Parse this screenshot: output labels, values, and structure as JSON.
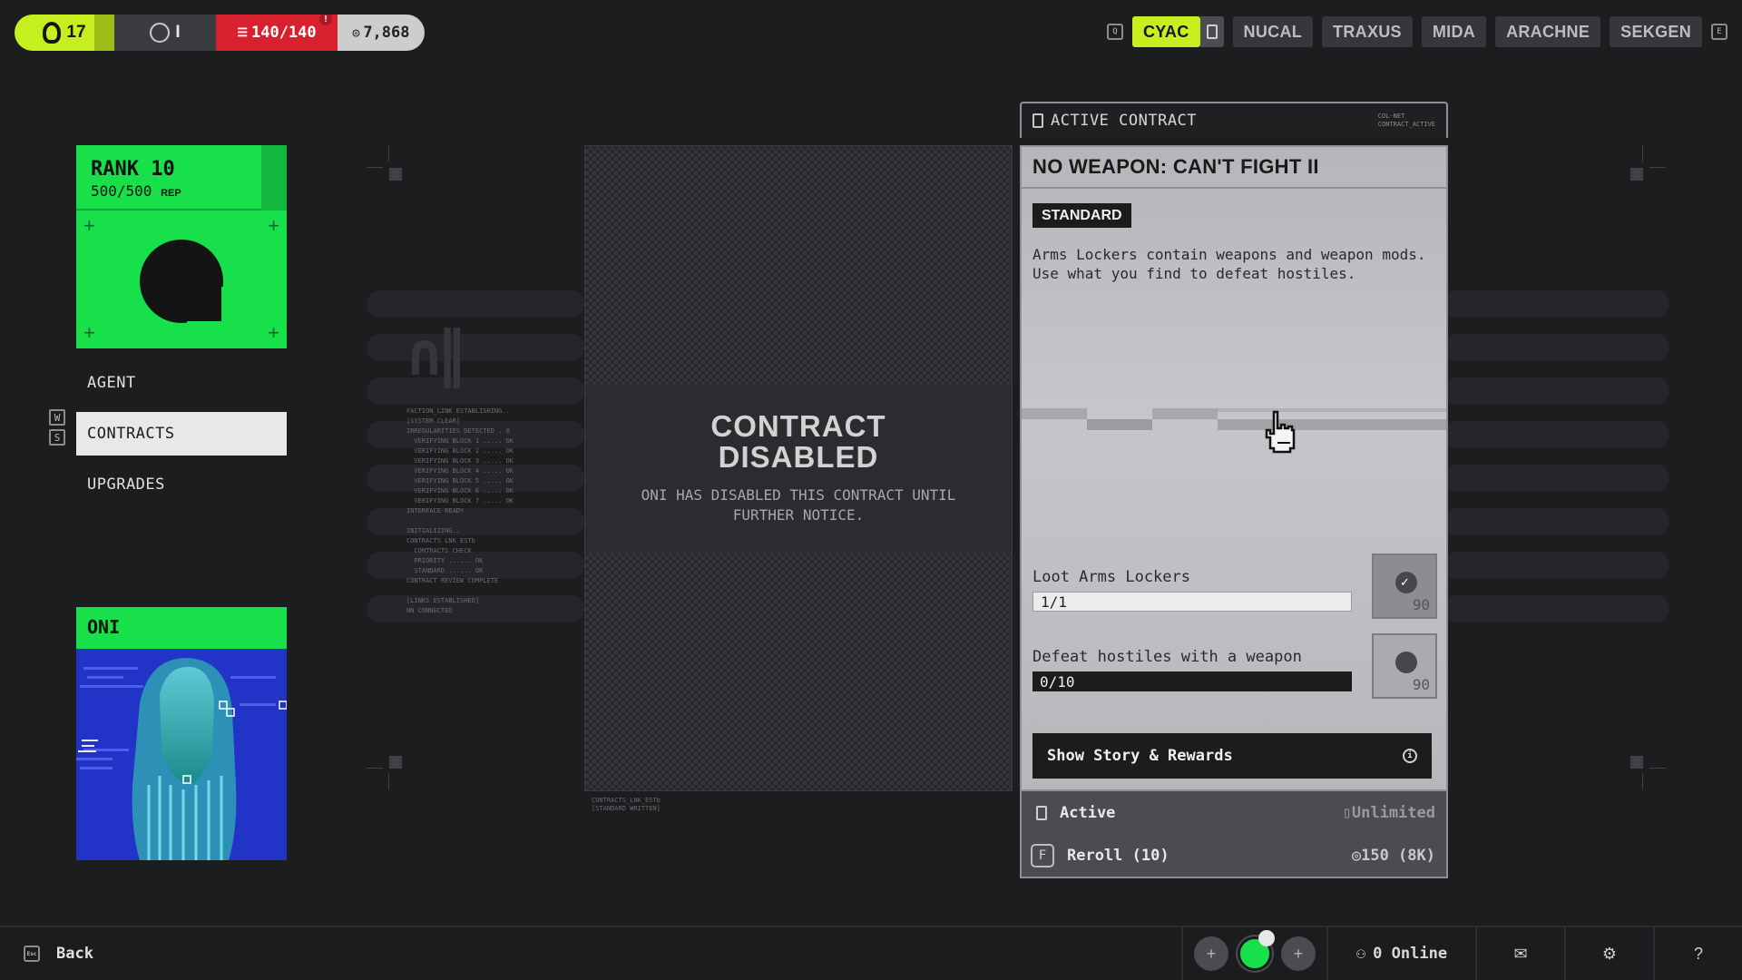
{
  "topbar": {
    "level": "17",
    "prestige": "I",
    "health": "140/140",
    "credits": "7,868"
  },
  "factions": {
    "prev_key": "Q",
    "next_key": "E",
    "tabs": [
      "CYAC",
      "NUCAL",
      "TRAXUS",
      "MIDA",
      "ARACHNE",
      "SEKGEN"
    ],
    "active": "CYAC"
  },
  "rank": {
    "title": "RANK 10",
    "rep": "500/500",
    "rep_unit": "REP"
  },
  "nav": {
    "keys": [
      "W",
      "S"
    ],
    "items": [
      "AGENT",
      "CONTRACTS",
      "UPGRADES"
    ],
    "selected": "CONTRACTS"
  },
  "handler": {
    "name": "ONI"
  },
  "disabled": {
    "title_line1": "CONTRACT",
    "title_line2": "DISABLED",
    "sub_line1": "ONI HAS DISABLED THIS CONTRACT UNTIL",
    "sub_line2": "FURTHER NOTICE.",
    "foot": "CONTRACTS_LNK_ESTb\n[STANDARD WRITTEN]"
  },
  "deco_log": "FACTION_LINK ESTABLISHING..\n[SYSTEM CLEAR]\nIRREGULARITIES DETECTED . 0\n  VERIFYING BLOCK 1 ..... OK\n  VERIFYING BLOCK 2 ..... OK\n  VERIFYING BLOCK 3 ..... OK\n  VERIFYING BLOCK 4 ..... OK\n  VERIFYING BLOCK 5 ..... OK\n  VERIFYING BLOCK 6 ..... OK\n  VERIFYING BLOCK 7 ..... OK\nINTERFACE READY\n\nINITIALIZING..\nCONTRACTS LNK ESTb\n  CONTRACTS CHECK\n  PRIORITY ...... OK\n  STANDARD ...... OK\nCONTRACT REVIEW COMPLETE\n\n[LINKS ESTABLISHED]\nNN CONNECTED",
  "contract": {
    "header_label": "ACTIVE CONTRACT",
    "header_meta": "COL-NET\nCONTRACT_ACTIVE",
    "title": "NO WEAPON: CAN'T FIGHT II",
    "tag": "STANDARD",
    "description": "Arms Lockers contain weapons and weapon mods. Use what you find to defeat hostiles.",
    "objectives": [
      {
        "label": "Loot Arms Lockers",
        "progress": "1/1",
        "reward": "90",
        "done": true
      },
      {
        "label": "Defeat hostiles with a weapon",
        "progress": "0/10",
        "reward": "90",
        "done": false
      }
    ],
    "story_button": "Show Story & Rewards",
    "status_label": "Active",
    "duration": "Unlimited",
    "reroll_key": "F",
    "reroll_label": "Reroll (10)",
    "reroll_cost": "150 (8K)"
  },
  "bottombar": {
    "back_key": "Esc",
    "back_label": "Back",
    "online": "0 Online"
  },
  "colors": {
    "accent": "#c6ef1f",
    "faction_green": "#18e04b",
    "danger": "#d8202e"
  }
}
